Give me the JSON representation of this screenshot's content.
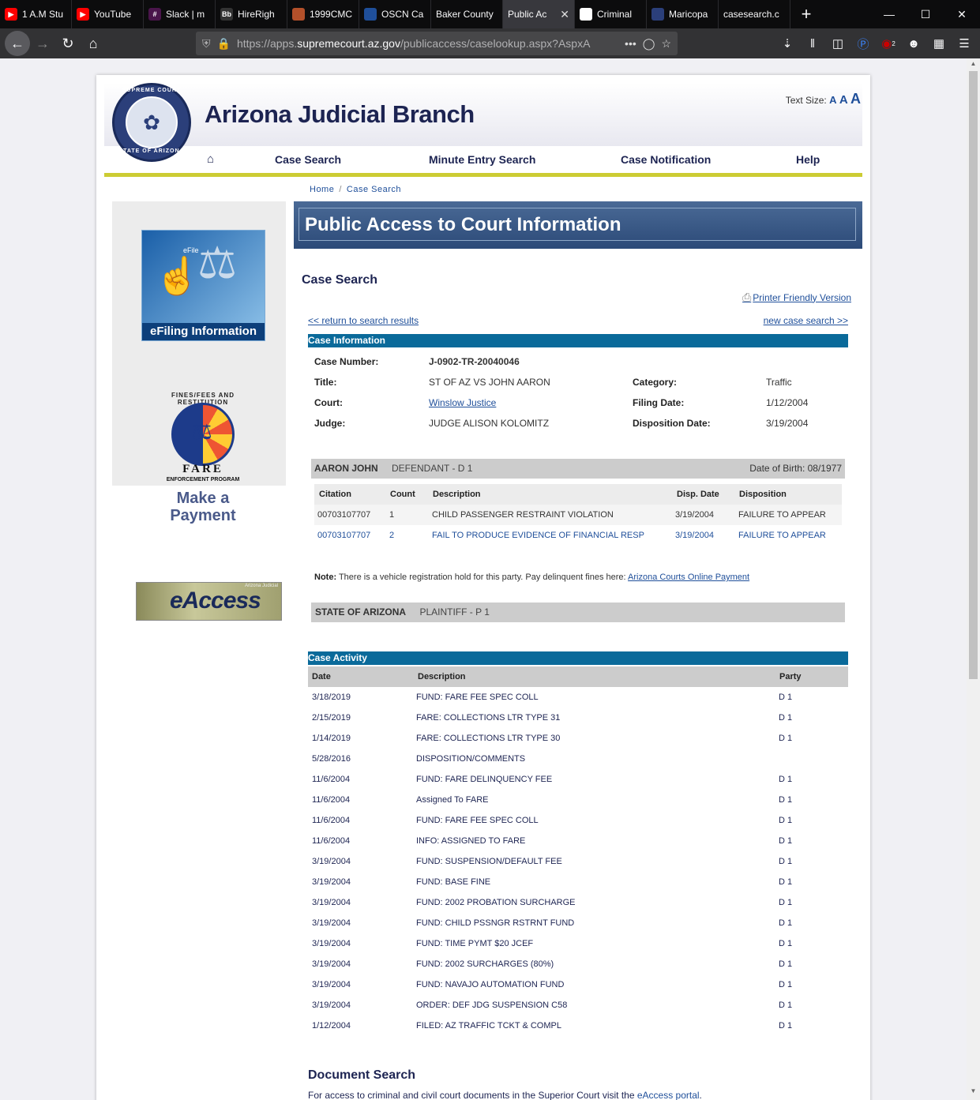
{
  "browser": {
    "tabs": [
      {
        "title": "1 A.M Stu",
        "icon_color": "#ff0000",
        "icon": "youtube-icon"
      },
      {
        "title": "YouTube",
        "icon_color": "#ff0000",
        "icon": "youtube-icon"
      },
      {
        "title": "Slack | m",
        "icon_color": "#4a154b",
        "icon": "slack-icon"
      },
      {
        "title": "HireRigh",
        "icon_color": "#333333",
        "icon": "blackboard-icon"
      },
      {
        "title": "1999CMC",
        "icon_color": "#b3502a",
        "icon": "seal-icon"
      },
      {
        "title": "OSCN Ca",
        "icon_color": "#1f4f9a",
        "icon": "shield-icon"
      },
      {
        "title": "Baker County",
        "icon_color": "",
        "icon": ""
      },
      {
        "title": "Public Ac",
        "icon_color": "",
        "icon": "",
        "active": true
      },
      {
        "title": "Criminal",
        "icon_color": "#ffffff",
        "icon": "page-icon"
      },
      {
        "title": "Maricopa",
        "icon_color": "#2b3f7a",
        "icon": "seal-icon"
      },
      {
        "title": "casesearch.c",
        "icon_color": "",
        "icon": ""
      }
    ],
    "url_prefix": "https://apps.",
    "url_domain": "supremecourt.az.gov",
    "url_rest": "/publicaccess/caselookup.aspx?AspxA",
    "more_label": "•••",
    "ublock_count": "2"
  },
  "header": {
    "site_title": "Arizona Judicial Branch",
    "seal_top": "SUPREME COURT",
    "seal_bottom": "STATE OF ARIZONA",
    "text_size_label": "Text Size:",
    "text_size_a": "A"
  },
  "menu": {
    "items": [
      "Case Search",
      "Minute Entry Search",
      "Case Notification",
      "Help"
    ]
  },
  "breadcrumb": {
    "home": "Home",
    "sep": "/",
    "current": "Case Search"
  },
  "sidebar": {
    "efile_label": "eFiling Information",
    "efile_tag": "eFile",
    "fare_arc": "FINES/FEES AND RESTITUTION",
    "fare_name": "FARE",
    "fare_program": "ENFORCEMENT PROGRAM",
    "make_payment": "Make a Payment",
    "eaccess_label": "eAccess",
    "eaccess_tag": "Arizona Judicial"
  },
  "banner": {
    "title": "Public Access to Court Information"
  },
  "case_search": {
    "heading": "Case Search",
    "printer_friendly": "Printer Friendly Version",
    "return_link": "<< return to search results",
    "new_search_link": "new case search >>"
  },
  "case_info": {
    "section_title": "Case Information",
    "case_number_label": "Case Number:",
    "case_number": "J-0902-TR-20040046",
    "title_label": "Title:",
    "title": "ST OF AZ VS JOHN AARON",
    "category_label": "Category:",
    "category": "Traffic",
    "court_label": "Court:",
    "court": "Winslow Justice",
    "filing_date_label": "Filing Date:",
    "filing_date": "1/12/2004",
    "judge_label": "Judge:",
    "judge": "JUDGE ALISON KOLOMITZ",
    "disposition_date_label": "Disposition Date:",
    "disposition_date": "3/19/2004"
  },
  "defendant": {
    "name": "AARON JOHN",
    "role": "DEFENDANT - D 1",
    "dob": "Date of Birth: 08/1977",
    "columns": [
      "Citation",
      "Count",
      "Description",
      "Disp. Date",
      "Disposition"
    ],
    "rows": [
      {
        "citation": "00703107707",
        "count": "1",
        "description": "CHILD PASSENGER RESTRAINT VIOLATION",
        "disp_date": "3/19/2004",
        "disposition": "FAILURE TO APPEAR"
      },
      {
        "citation": "00703107707",
        "count": "2",
        "description": "FAIL TO PRODUCE EVIDENCE OF FINANCIAL RESP",
        "disp_date": "3/19/2004",
        "disposition": "FAILURE TO APPEAR"
      }
    ],
    "note_label": "Note:",
    "note_text": " There is a vehicle registration hold for this party. Pay delinquent fines here: ",
    "note_link": "Arizona Courts Online Payment"
  },
  "plaintiff": {
    "name": "STATE OF ARIZONA",
    "role": "PLAINTIFF - P 1"
  },
  "case_activity": {
    "section_title": "Case Activity",
    "columns": [
      "Date",
      "Description",
      "Party"
    ],
    "rows": [
      {
        "date": "3/18/2019",
        "description": "FUND: FARE FEE SPEC COLL",
        "party": "D 1"
      },
      {
        "date": "2/15/2019",
        "description": "FARE: COLLECTIONS LTR TYPE 31",
        "party": "D 1"
      },
      {
        "date": "1/14/2019",
        "description": "FARE: COLLECTIONS LTR TYPE 30",
        "party": "D 1"
      },
      {
        "date": "5/28/2016",
        "description": "DISPOSITION/COMMENTS",
        "party": ""
      },
      {
        "date": "11/6/2004",
        "description": "FUND: FARE DELINQUENCY FEE",
        "party": "D 1"
      },
      {
        "date": "11/6/2004",
        "description": "Assigned To FARE",
        "party": "D 1"
      },
      {
        "date": "11/6/2004",
        "description": "FUND: FARE FEE SPEC COLL",
        "party": "D 1"
      },
      {
        "date": "11/6/2004",
        "description": "INFO: ASSIGNED TO FARE",
        "party": "D 1"
      },
      {
        "date": "3/19/2004",
        "description": "FUND: SUSPENSION/DEFAULT FEE",
        "party": "D 1"
      },
      {
        "date": "3/19/2004",
        "description": "FUND: BASE FINE",
        "party": "D 1"
      },
      {
        "date": "3/19/2004",
        "description": "FUND: 2002 PROBATION SURCHARGE",
        "party": "D 1"
      },
      {
        "date": "3/19/2004",
        "description": "FUND: CHILD PSSNGR RSTRNT FUND",
        "party": "D 1"
      },
      {
        "date": "3/19/2004",
        "description": "FUND: TIME PYMT $20 JCEF",
        "party": "D 1"
      },
      {
        "date": "3/19/2004",
        "description": "FUND: 2002 SURCHARGES (80%)",
        "party": "D 1"
      },
      {
        "date": "3/19/2004",
        "description": "FUND: NAVAJO AUTOMATION FUND",
        "party": "D 1"
      },
      {
        "date": "3/19/2004",
        "description": "ORDER: DEF JDG SUSPENSION C58",
        "party": "D 1"
      },
      {
        "date": "1/12/2004",
        "description": "FILED: AZ TRAFFIC TCKT & COMPL",
        "party": "D 1"
      }
    ]
  },
  "document_search": {
    "heading": "Document Search",
    "text": "For access to criminal and civil court documents in the Superior Court visit the ",
    "link": "eAccess portal",
    "end": "."
  }
}
